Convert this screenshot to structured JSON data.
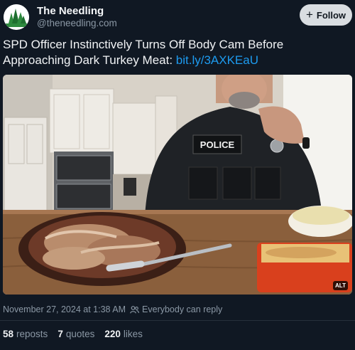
{
  "post": {
    "display_name": "The Needling",
    "handle": "@theneedling.com",
    "follow_label": "Follow",
    "text": "SPD Officer Instinctively Turns Off Body Cam Before Approaching Dark Turkey Meat: ",
    "link_text": "bit.ly/3AXKEaU",
    "image": {
      "vest_text": "POLICE",
      "alt_badge": "ALT"
    },
    "timestamp": "November 27, 2024 at 1:38 AM",
    "reply_setting": "Everybody can reply"
  },
  "stats": {
    "reposts_count": "58",
    "reposts_label": "reposts",
    "quotes_count": "7",
    "quotes_label": "quotes",
    "likes_count": "220",
    "likes_label": "likes"
  },
  "colors": {
    "background": "#101823",
    "link": "#1d9bf0",
    "muted": "#8b98a5",
    "follow_button": "#d9dde1"
  },
  "icons": [
    "needling-logo-icon",
    "plus-icon",
    "people-icon"
  ]
}
